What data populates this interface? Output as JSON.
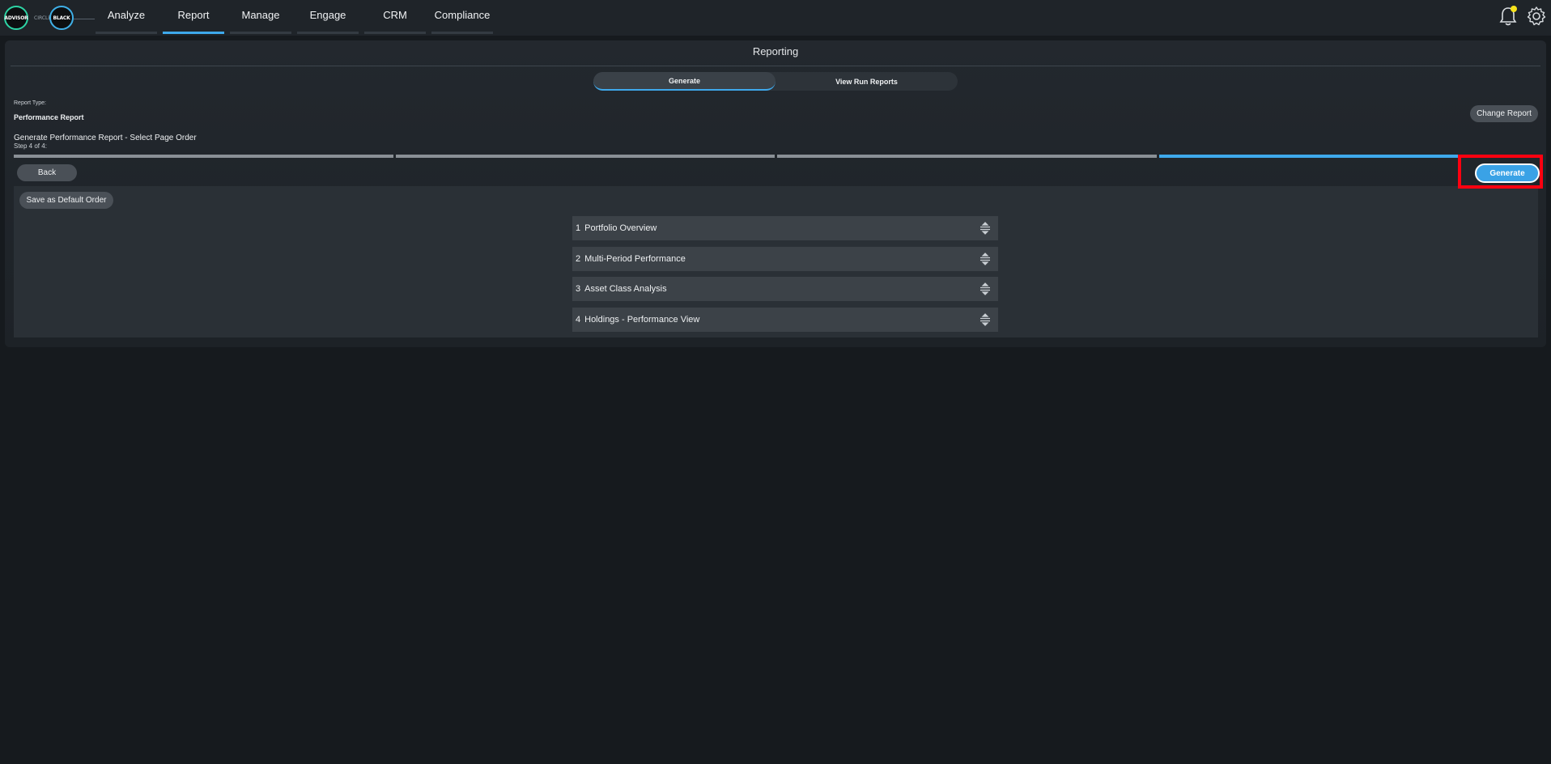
{
  "logo": {
    "left_text": "ADVISOR",
    "mid_text": "CIRCLE",
    "right_text": "BLACK"
  },
  "nav": [
    {
      "label": "Analyze",
      "active": false
    },
    {
      "label": "Report",
      "active": true
    },
    {
      "label": "Manage",
      "active": false
    },
    {
      "label": "Engage",
      "active": false
    },
    {
      "label": "CRM",
      "active": false
    },
    {
      "label": "Compliance",
      "active": false
    }
  ],
  "icons": {
    "notifications": "bell-icon",
    "settings": "gear-icon",
    "drag": "drag-handle-icon"
  },
  "colors": {
    "accent": "#3ea9ec",
    "highlight": "#ff0010",
    "notification_dot": "#f6e21b"
  },
  "page": {
    "title": "Reporting"
  },
  "tabs": {
    "generate": "Generate",
    "view_run_reports": "View Run Reports"
  },
  "report": {
    "type_label": "Report Type:",
    "type_value": "Performance Report",
    "change_label": "Change Report"
  },
  "step": {
    "title": "Generate Performance Report - Select Page Order",
    "count": "Step 4 of 4:",
    "current": 4,
    "total": 4
  },
  "actions": {
    "back": "Back",
    "generate": "Generate",
    "save_default": "Save as Default Order"
  },
  "pages": [
    {
      "num": "1",
      "name": "Portfolio Overview"
    },
    {
      "num": "2",
      "name": "Multi-Period Performance"
    },
    {
      "num": "3",
      "name": "Asset Class Analysis"
    },
    {
      "num": "4",
      "name": "Holdings - Performance View"
    }
  ]
}
